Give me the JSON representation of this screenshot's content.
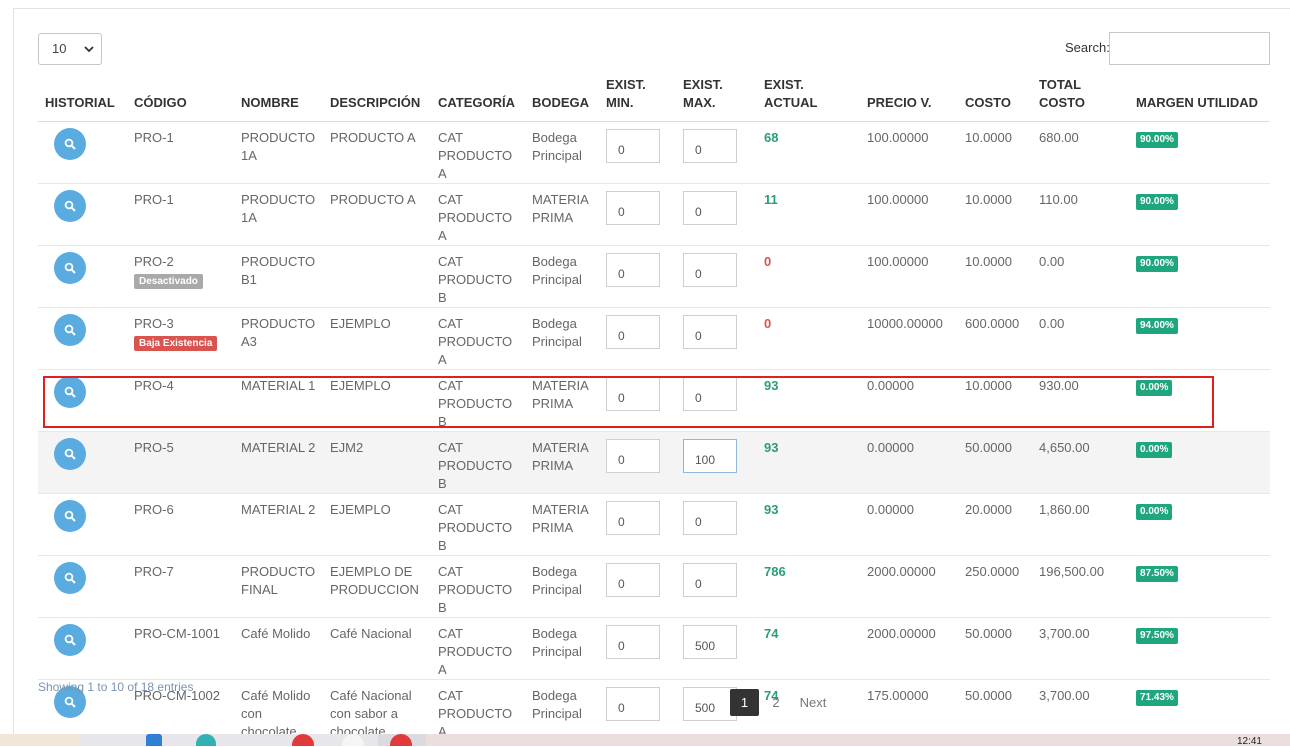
{
  "length_menu": {
    "value": "10"
  },
  "search": {
    "label": "Search:",
    "value": ""
  },
  "columns": [
    {
      "key": "historial",
      "l1": "",
      "l2": "HISTORIAL"
    },
    {
      "key": "codigo",
      "l1": "",
      "l2": "CÓDIGO"
    },
    {
      "key": "nombre",
      "l1": "",
      "l2": "NOMBRE"
    },
    {
      "key": "descripcion",
      "l1": "",
      "l2": "DESCRIPCIÓN"
    },
    {
      "key": "categoria",
      "l1": "",
      "l2": "CATEGORÍA"
    },
    {
      "key": "bodega",
      "l1": "",
      "l2": "BODEGA"
    },
    {
      "key": "exist_min",
      "l1": "EXIST.",
      "l2": "MIN."
    },
    {
      "key": "exist_max",
      "l1": "EXIST.",
      "l2": "MAX."
    },
    {
      "key": "exist_actual",
      "l1": "EXIST.",
      "l2": "ACTUAL"
    },
    {
      "key": "precio_v",
      "l1": "",
      "l2": "PRECIO V."
    },
    {
      "key": "costo",
      "l1": "",
      "l2": "COSTO"
    },
    {
      "key": "total_costo",
      "l1": "TOTAL",
      "l2": "COSTO"
    },
    {
      "key": "margen",
      "l1": "",
      "l2": "MARGEN UTILIDAD"
    }
  ],
  "rows": [
    {
      "code": "PRO-1",
      "badge": "",
      "name": "PRODUCTO 1A",
      "desc": "PRODUCTO A",
      "cat": "CAT PRODUCTO A",
      "bodega": "Bodega Principal",
      "min": "0",
      "max": "0",
      "actual": "68",
      "actual_zero": false,
      "precio": "100.00000",
      "costo": "10.0000",
      "total": "680.00",
      "margen": "90.00%"
    },
    {
      "code": "PRO-1",
      "badge": "",
      "name": "PRODUCTO 1A",
      "desc": "PRODUCTO A",
      "cat": "CAT PRODUCTO A",
      "bodega": "MATERIA PRIMA",
      "min": "0",
      "max": "0",
      "actual": "11",
      "actual_zero": false,
      "precio": "100.00000",
      "costo": "10.0000",
      "total": "110.00",
      "margen": "90.00%"
    },
    {
      "code": "PRO-2",
      "badge": "Desactivado",
      "badge_type": "off",
      "name": "PRODUCTO B1",
      "desc": "",
      "cat": "CAT PRODUCTO B",
      "bodega": "Bodega Principal",
      "min": "0",
      "max": "0",
      "actual": "0",
      "actual_zero": true,
      "precio": "100.00000",
      "costo": "10.0000",
      "total": "0.00",
      "margen": "90.00%"
    },
    {
      "code": "PRO-3",
      "badge": "Baja Existencia",
      "badge_type": "low",
      "name": "PRODUCTO A3",
      "desc": "EJEMPLO",
      "cat": "CAT PRODUCTO A",
      "bodega": "Bodega Principal",
      "min": "0",
      "max": "0",
      "actual": "0",
      "actual_zero": true,
      "precio": "10000.00000",
      "costo": "600.0000",
      "total": "0.00",
      "margen": "94.00%"
    },
    {
      "code": "PRO-4",
      "badge": "",
      "name": "MATERIAL 1",
      "desc": "EJEMPLO",
      "cat": "CAT PRODUCTO B",
      "bodega": "MATERIA PRIMA",
      "min": "0",
      "max": "0",
      "actual": "93",
      "actual_zero": false,
      "precio": "0.00000",
      "costo": "10.0000",
      "total": "930.00",
      "margen": "0.00%"
    },
    {
      "code": "PRO-5",
      "badge": "",
      "name": "MATERIAL 2",
      "desc": "EJM2",
      "cat": "CAT PRODUCTO B",
      "bodega": "MATERIA PRIMA",
      "min": "0",
      "max": "100",
      "actual": "93",
      "actual_zero": false,
      "precio": "0.00000",
      "costo": "50.0000",
      "total": "4,650.00",
      "margen": "0.00%",
      "highlight": true
    },
    {
      "code": "PRO-6",
      "badge": "",
      "name": "MATERIAL 2",
      "desc": "EJEMPLO",
      "cat": "CAT PRODUCTO B",
      "bodega": "MATERIA PRIMA",
      "min": "0",
      "max": "0",
      "actual": "93",
      "actual_zero": false,
      "precio": "0.00000",
      "costo": "20.0000",
      "total": "1,860.00",
      "margen": "0.00%"
    },
    {
      "code": "PRO-7",
      "badge": "",
      "name": "PRODUCTO FINAL",
      "desc": "EJEMPLO DE PRODUCCION",
      "cat": "CAT PRODUCTO B",
      "bodega": "Bodega Principal",
      "min": "0",
      "max": "0",
      "actual": "786",
      "actual_zero": false,
      "precio": "2000.00000",
      "costo": "250.0000",
      "total": "196,500.00",
      "margen": "87.50%"
    },
    {
      "code": "PRO-CM-1001",
      "badge": "",
      "name": "Café Molido",
      "desc": "Café Nacional",
      "cat": "CAT PRODUCTO A",
      "bodega": "Bodega Principal",
      "min": "0",
      "max": "500",
      "actual": "74",
      "actual_zero": false,
      "precio": "2000.00000",
      "costo": "50.0000",
      "total": "3,700.00",
      "margen": "97.50%"
    },
    {
      "code": "PRO-CM-1002",
      "badge": "",
      "name": "Café Molido con chocolate",
      "desc": "Café Nacional con sabor a chocolate",
      "cat": "CAT PRODUCTO A",
      "bodega": "Bodega Principal",
      "min": "0",
      "max": "500",
      "actual": "74",
      "actual_zero": false,
      "precio": "175.00000",
      "costo": "50.0000",
      "total": "3,700.00",
      "margen": "71.43%"
    }
  ],
  "footer": {
    "info": "Showing 1 to 10 of 18 entries",
    "pages": [
      "1",
      "2"
    ],
    "active_page": "1",
    "next_label": "Next"
  },
  "clock": "12:41",
  "colors": {
    "stock_ok": "#2a9d7b",
    "stock_zero": "#d9534f",
    "margin_badge": "#20a67f",
    "history_button": "#5aace0",
    "highlight_border": "#e01f1f"
  }
}
